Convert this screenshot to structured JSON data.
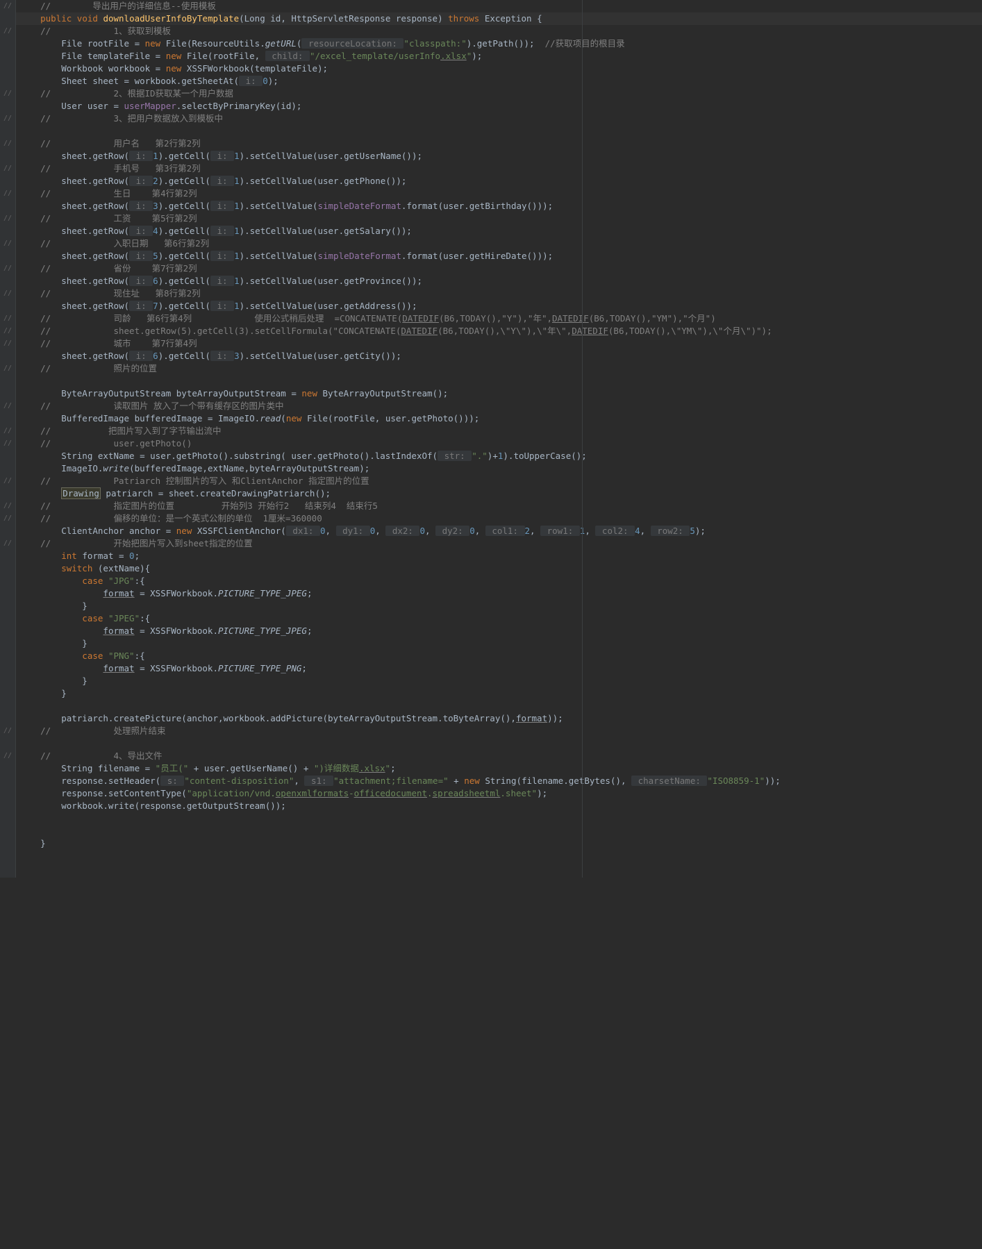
{
  "lines": {
    "l1_cmt": "//        导出用户的详细信息--使用模板",
    "l2": {
      "kw1": "public ",
      "kw2": "void ",
      "mth": "downloadUserInfoByTemplate",
      "p": "(Long id, HttpServletResponse response) ",
      "kw3": "throws ",
      "p2": "Exception {"
    },
    "l3_cmt": "//            1、获取到模板",
    "l4": {
      "a": "        File rootFile = ",
      "kw": "new ",
      "b": "File(ResourceUtils.",
      "st": "getURL",
      "c": "(",
      "hint": " resourceLocation: ",
      "str": "\"classpath:\"",
      "d": ").getPath());  ",
      "cmt": "//获取项目的根目录"
    },
    "l5": {
      "a": "        File templateFile = ",
      "kw": "new ",
      "b": "File(rootFile, ",
      "hint": " child: ",
      "str1": "\"/excel_template/userInfo",
      "str2": ".xlsx",
      "str3": "\"",
      "c": ");"
    },
    "l6": {
      "a": "        Workbook workbook = ",
      "kw": "new ",
      "b": "XSSFWorkbook(templateFile);"
    },
    "l7": {
      "a": "        Sheet sheet = workbook.getSheetAt(",
      "hint": " i: ",
      "num": "0",
      "b": ");"
    },
    "l8_cmt": "//            2、根据ID获取某一个用户数据",
    "l9": {
      "a": "        User user = ",
      "fld": "userMapper",
      "b": ".selectByPrimaryKey(id);"
    },
    "l10_cmt": "//            3、把用户数据放入到模板中",
    "l11_blank": "",
    "l12_cmt": "//            用户名   第2行第2列",
    "l13": {
      "a": "        sheet.getRow(",
      "h1": " i: ",
      "n1": "1",
      "b": ").getCell(",
      "h2": " i: ",
      "n2": "1",
      "c": ").setCellValue(user.getUserName());"
    },
    "l14_cmt": "//            手机号   第3行第2列",
    "l15": {
      "a": "        sheet.getRow(",
      "h1": " i: ",
      "n1": "2",
      "b": ").getCell(",
      "h2": " i: ",
      "n2": "1",
      "c": ").setCellValue(user.getPhone());"
    },
    "l16_cmt": "//            生日    第4行第2列",
    "l17": {
      "a": "        sheet.getRow(",
      "h1": " i: ",
      "n1": "3",
      "b": ").getCell(",
      "h2": " i: ",
      "n2": "1",
      "c": ").setCellValue(",
      "fld": "simpleDateFormat",
      "d": ".format(user.getBirthday()));"
    },
    "l18_cmt": "//            工资    第5行第2列",
    "l19": {
      "a": "        sheet.getRow(",
      "h1": " i: ",
      "n1": "4",
      "b": ").getCell(",
      "h2": " i: ",
      "n2": "1",
      "c": ").setCellValue(user.getSalary());"
    },
    "l20_cmt": "//            入职日期   第6行第2列",
    "l21": {
      "a": "        sheet.getRow(",
      "h1": " i: ",
      "n1": "5",
      "b": ").getCell(",
      "h2": " i: ",
      "n2": "1",
      "c": ").setCellValue(",
      "fld": "simpleDateFormat",
      "d": ".format(user.getHireDate()));"
    },
    "l22_cmt": "//            省份    第7行第2列",
    "l23": {
      "a": "        sheet.getRow(",
      "h1": " i: ",
      "n1": "6",
      "b": ").getCell(",
      "h2": " i: ",
      "n2": "1",
      "c": ").setCellValue(user.getProvince());"
    },
    "l24_cmt": "//            现住址   第8行第2列",
    "l25": {
      "a": "        sheet.getRow(",
      "h1": " i: ",
      "n1": "7",
      "b": ").getCell(",
      "h2": " i: ",
      "n2": "1",
      "c": ").setCellValue(user.getAddress());"
    },
    "l26_cmt1": "//            司龄   第6行第4列            使用公式稍后处理  =CONCATENATE(",
    "l26_u1": "DATEDIF",
    "l26_cmt2": "(B6,TODAY(),\"Y\"),\"年\",",
    "l26_u2": "DATEDIF",
    "l26_cmt3": "(B6,TODAY(),\"YM\"),\"个月\")",
    "l27_cmt1": "//            sheet.getRow(5).getCell(3).setCellFormula(\"CONCATENATE(",
    "l27_u1": "DATEDIF",
    "l27_cmt2": "(B6,TODAY(),\\\"Y\\\"),\\\"年\\\",",
    "l27_u2": "DATEDIF",
    "l27_cmt3": "(B6,TODAY(),\\\"YM\\\"),\\\"个月\\\")\");",
    "l28_cmt": "//            城市    第7行第4列",
    "l29": {
      "a": "        sheet.getRow(",
      "h1": " i: ",
      "n1": "6",
      "b": ").getCell(",
      "h2": " i: ",
      "n2": "3",
      "c": ").setCellValue(user.getCity());"
    },
    "l30_cmt": "//            照片的位置",
    "l31_blank": "",
    "l32": {
      "a": "        ByteArrayOutputStream byteArrayOutputStream = ",
      "kw": "new ",
      "b": "ByteArrayOutputStream();"
    },
    "l33_cmt": "//            读取图片 放入了一个带有缓存区的图片类中",
    "l34": {
      "a": "        BufferedImage bufferedImage = ImageIO.",
      "st": "read",
      "b": "(",
      "kw": "new ",
      "c": "File(rootFile, user.getPhoto()));"
    },
    "l35_cmt": "//           把图片写入到了字节输出流中",
    "l36_cmt": "//            user.getPhoto()",
    "l37": {
      "a": "        String extName = user.getPhoto().substring( user.getPhoto().lastIndexOf(",
      "hint": " str: ",
      "str": "\".\"",
      "b": ")+",
      "n": "1",
      "c": ").toUpperCase();"
    },
    "l38": {
      "a": "        ImageIO.",
      "st": "write",
      "b": "(bufferedImage,extName,byteArrayOutputStream);"
    },
    "l39_cmt": "//            Patriarch 控制图片的写入 和ClientAnchor 指定图片的位置",
    "l40": {
      "a": "        ",
      "box": "Drawing",
      "b": " patriarch = sheet.createDrawingPatriarch();"
    },
    "l41_cmt": "//            指定图片的位置         开始列3 开始行2   结束列4  结束行5",
    "l42_cmt": "//            偏移的单位：是一个英式公制的单位  1厘米=360000",
    "l43": {
      "a": "        ClientAnchor anchor = ",
      "kw": "new ",
      "b": "XSSFClientAnchor(",
      "h1": " dx1: ",
      "n1": "0",
      "c1": ", ",
      "h2": " dy1: ",
      "n2": "0",
      "c2": ", ",
      "h3": " dx2: ",
      "n3": "0",
      "c3": ", ",
      "h4": " dy2: ",
      "n4": "0",
      "c4": ", ",
      "h5": " col1: ",
      "n5": "2",
      "c5": ", ",
      "h6": " row1: ",
      "n6": "1",
      "c6": ", ",
      "h7": " col2: ",
      "n7": "4",
      "c7": ", ",
      "h8": " row2: ",
      "n8": "5",
      "c8": ");"
    },
    "l44_cmt": "//            开始把图片写入到sheet指定的位置",
    "l45": {
      "kw": "        int ",
      "a": "format = ",
      "n": "0",
      "b": ";"
    },
    "l46": {
      "kw": "        switch ",
      "a": "(extName){"
    },
    "l47": {
      "kw": "            case ",
      "str": "\"JPG\"",
      "a": ":{"
    },
    "l48": {
      "a": "                ",
      "u": "format",
      "b": " = XSSFWorkbook.",
      "st": "PICTURE_TYPE_JPEG",
      "c": ";"
    },
    "l49_brace": "            }",
    "l50": {
      "kw": "            case ",
      "str": "\"JPEG\"",
      "a": ":{"
    },
    "l51": {
      "a": "                ",
      "u": "format",
      "b": " = XSSFWorkbook.",
      "st": "PICTURE_TYPE_JPEG",
      "c": ";"
    },
    "l52_brace": "            }",
    "l53": {
      "kw": "            case ",
      "str": "\"PNG\"",
      "a": ":{"
    },
    "l54": {
      "a": "                ",
      "u": "format",
      "b": " = XSSFWorkbook.",
      "st": "PICTURE_TYPE_PNG",
      "c": ";"
    },
    "l55_brace": "            }",
    "l56_brace": "        }",
    "l57_blank": "",
    "l58": {
      "a": "        patriarch.createPicture(anchor,workbook.addPicture(byteArrayOutputStream.toByteArray(),",
      "u": "format",
      "b": "));"
    },
    "l59_cmt": "//            处理照片结束",
    "l60_blank": "",
    "l61_cmt": "//            4、导出文件",
    "l62": {
      "a": "        String filename = ",
      "s1": "\"员工(\"",
      "b": " + user.getUserName() + ",
      "s2": "\")详细数据",
      "s3": ".xlsx",
      "s4": "\"",
      "c": ";"
    },
    "l63": {
      "a": "        response.setHeader(",
      "h1": " s: ",
      "s1": "\"content-disposition\"",
      "b": ", ",
      "h2": " s1: ",
      "s2": "\"attachment;filename=\"",
      "c": " + ",
      "kw": "new ",
      "d": "String(filename.getBytes(), ",
      "h3": " charsetName: ",
      "s3": "\"ISO8859-1\"",
      "e": "));"
    },
    "l64": {
      "a": "        response.setContentType(",
      "s1": "\"application/vnd.",
      "u1": "openxmlformats",
      "s2": "-",
      "u2": "officedocument",
      "s3": ".",
      "u3": "spreadsheetml",
      "s4": ".sheet\"",
      "b": ");"
    },
    "l65": {
      "a": "        workbook.write(response.getOutputStream());"
    },
    "l66_blank": "",
    "l67_blank": "",
    "l68_brace": "    }"
  },
  "markers": {
    "m1": "//",
    "m2": "//"
  }
}
